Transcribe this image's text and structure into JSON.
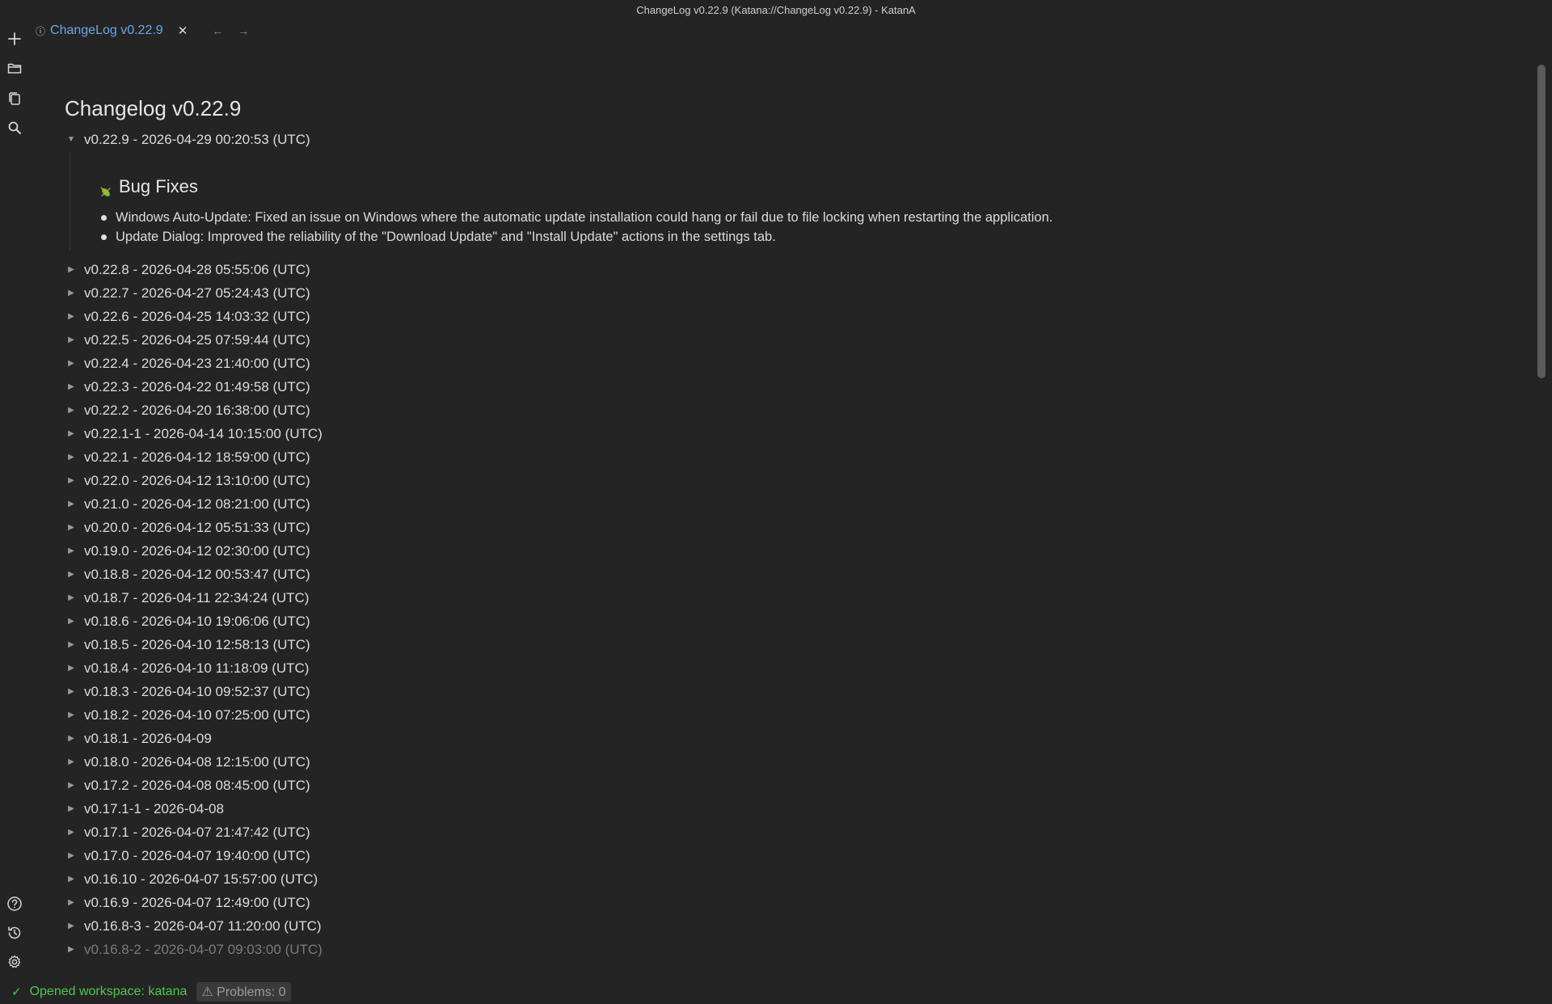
{
  "window": {
    "title": "ChangeLog v0.22.9 (Katana://ChangeLog v0.22.9) - KatanA"
  },
  "sidebar": {
    "top_icons": [
      "plus-icon",
      "folder-open-icon",
      "copy-icon",
      "search-icon"
    ],
    "bottom_icons": [
      "help-icon",
      "history-icon",
      "gear-icon"
    ]
  },
  "tabs": [
    {
      "label": "ChangeLog v0.22.9",
      "icon": "info-icon",
      "active": true
    }
  ],
  "nav": {
    "back": "←",
    "forward": "→"
  },
  "page": {
    "title": "Changelog v0.22.9",
    "expanded": {
      "label": "v0.22.9 - 2026-04-29 00:20:53 (UTC)",
      "section_heading": "Bug Fixes",
      "section_icon": "bug-icon",
      "bullets": [
        "Windows Auto-Update: Fixed an issue on Windows where the automatic update installation could hang or fail due to file locking when restarting the application.",
        "Update Dialog: Improved the reliability of the \"Download Update\" and \"Install Update\" actions in the settings tab."
      ]
    },
    "entries": [
      "v0.22.8 - 2026-04-28 05:55:06 (UTC)",
      "v0.22.7 - 2026-04-27 05:24:43 (UTC)",
      "v0.22.6 - 2026-04-25 14:03:32 (UTC)",
      "v0.22.5 - 2026-04-25 07:59:44 (UTC)",
      "v0.22.4 - 2026-04-23 21:40:00 (UTC)",
      "v0.22.3 - 2026-04-22 01:49:58 (UTC)",
      "v0.22.2 - 2026-04-20 16:38:00 (UTC)",
      "v0.22.1-1 - 2026-04-14 10:15:00 (UTC)",
      "v0.22.1 - 2026-04-12 18:59:00 (UTC)",
      "v0.22.0 - 2026-04-12 13:10:00 (UTC)",
      "v0.21.0 - 2026-04-12 08:21:00 (UTC)",
      "v0.20.0 - 2026-04-12 05:51:33 (UTC)",
      "v0.19.0 - 2026-04-12 02:30:00 (UTC)",
      "v0.18.8 - 2026-04-12 00:53:47 (UTC)",
      "v0.18.7 - 2026-04-11 22:34:24 (UTC)",
      "v0.18.6 - 2026-04-10 19:06:06 (UTC)",
      "v0.18.5 - 2026-04-10 12:58:13 (UTC)",
      "v0.18.4 - 2026-04-10 11:18:09 (UTC)",
      "v0.18.3 - 2026-04-10 09:52:37 (UTC)",
      "v0.18.2 - 2026-04-10 07:25:00 (UTC)",
      "v0.18.1 - 2026-04-09",
      "v0.18.0 - 2026-04-08 12:15:00 (UTC)",
      "v0.17.2 - 2026-04-08 08:45:00 (UTC)",
      "v0.17.1-1 - 2026-04-08",
      "v0.17.1 - 2026-04-07 21:47:42 (UTC)",
      "v0.17.0 - 2026-04-07 19:40:00 (UTC)",
      "v0.16.10 - 2026-04-07 15:57:00 (UTC)",
      "v0.16.9 - 2026-04-07 12:49:00 (UTC)",
      "v0.16.8-3 - 2026-04-07 11:20:00 (UTC)",
      "v0.16.8-2 - 2026-04-07 09:03:00 (UTC)"
    ]
  },
  "status": {
    "workspace_text": "Opened workspace: katana",
    "problems_text": "⚠ Problems: 0",
    "ok_color": "#4ec94e"
  },
  "colors": {
    "background": "#242424",
    "tab_active": "#6aa6e8",
    "text": "#dcdcdc"
  }
}
